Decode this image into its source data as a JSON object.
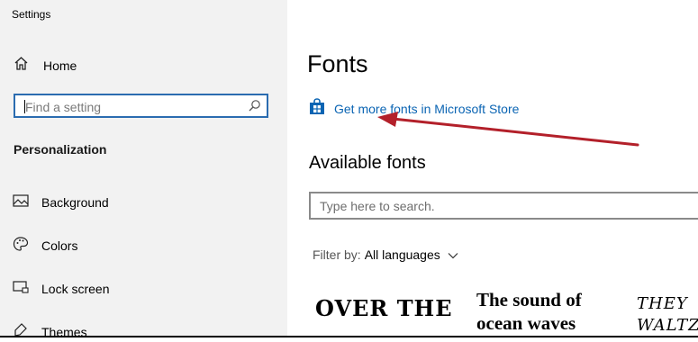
{
  "app_title": "Settings",
  "sidebar": {
    "home_label": "Home",
    "search_placeholder": "Find a setting",
    "section_label": "Personalization",
    "items": [
      {
        "label": "Background",
        "icon": "picture-icon"
      },
      {
        "label": "Colors",
        "icon": "palette-icon"
      },
      {
        "label": "Lock screen",
        "icon": "monitor-lock-icon"
      },
      {
        "label": "Themes",
        "icon": "brush-icon"
      }
    ]
  },
  "main": {
    "title": "Fonts",
    "store_link": "Get more fonts in Microsoft Store",
    "available_heading": "Available fonts",
    "search_placeholder": "Type here to search.",
    "filter_label": "Filter by:",
    "filter_value": "All languages",
    "previews": [
      "OVER THE",
      "The sound of ocean waves",
      "THEY WALTZ"
    ]
  },
  "colors": {
    "link": "#0a64b3",
    "search_border_focus": "#2b6cb0",
    "annotation_arrow": "#b3202a"
  }
}
